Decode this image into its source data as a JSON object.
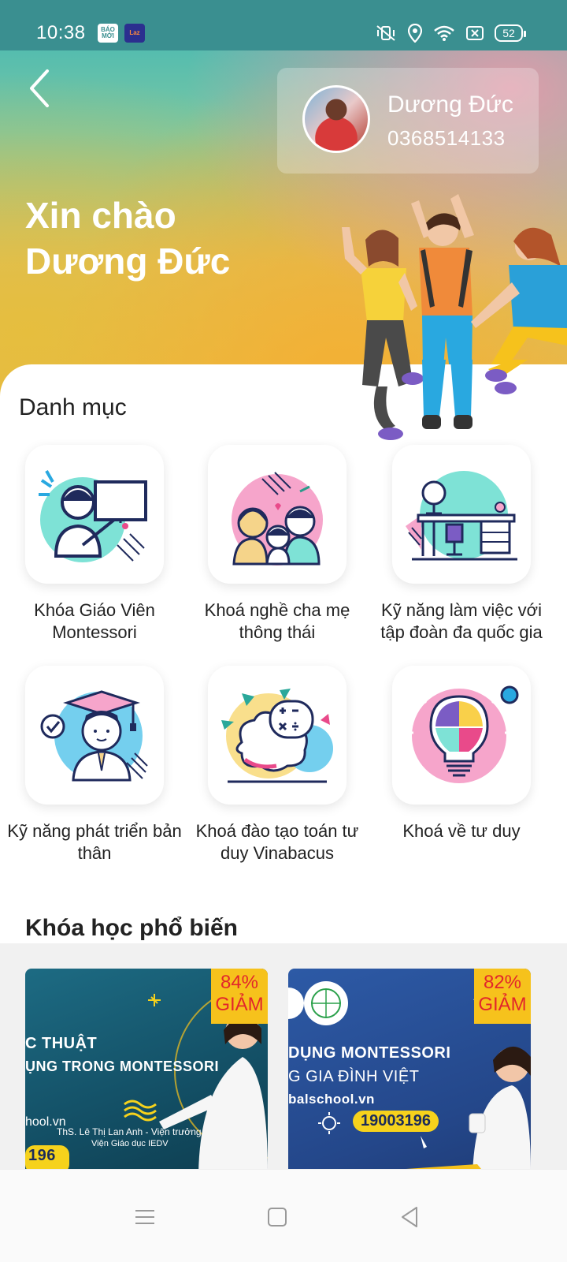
{
  "status_bar": {
    "time": "10:38",
    "apps": [
      "BÁO MỚI",
      "Laz"
    ],
    "battery": "52"
  },
  "profile": {
    "name": "Dương Đức",
    "phone": "0368514133"
  },
  "greeting": {
    "line1": "Xin chào",
    "line2": "Dương Đức"
  },
  "categories": {
    "title": "Danh mục",
    "items": [
      {
        "label": "Khóa Giáo Viên Montessori",
        "icon": "teacher-board-icon"
      },
      {
        "label": "Khoá nghề cha mẹ thông thái",
        "icon": "family-icon"
      },
      {
        "label": "Kỹ năng làm việc với tập đoàn đa quốc gia",
        "icon": "office-desk-icon"
      },
      {
        "label": "Kỹ năng phát triển bản thân",
        "icon": "graduate-icon"
      },
      {
        "label": "Khoá đào tạo toán tư duy Vinabacus",
        "icon": "brain-math-icon"
      },
      {
        "label": "Khoá về tư duy",
        "icon": "puzzle-bulb-icon"
      }
    ]
  },
  "popular": {
    "title": "Khóa học phổ biến",
    "courses": [
      {
        "discount_value": "84%",
        "discount_label": "GIẢM",
        "line1": "C THUẬT",
        "line2": "ỤNG TRONG MONTESSORI",
        "site": "hool.vn",
        "author": "ThS. Lê Thị Lan Anh - Viện trưởng",
        "org": "Viện Giáo dục IEDV",
        "phone": "196"
      },
      {
        "discount_value": "82%",
        "discount_label": "GIẢM",
        "line1": "DỤNG MONTESSORI",
        "line2": "G GIA ĐÌNH VIỆT",
        "site": "balschool.vn",
        "phone": "19003196"
      }
    ]
  },
  "colors": {
    "status_bar": "#3a8f90",
    "discount_bg": "#f6c21c",
    "discount_text": "#e2262b"
  }
}
